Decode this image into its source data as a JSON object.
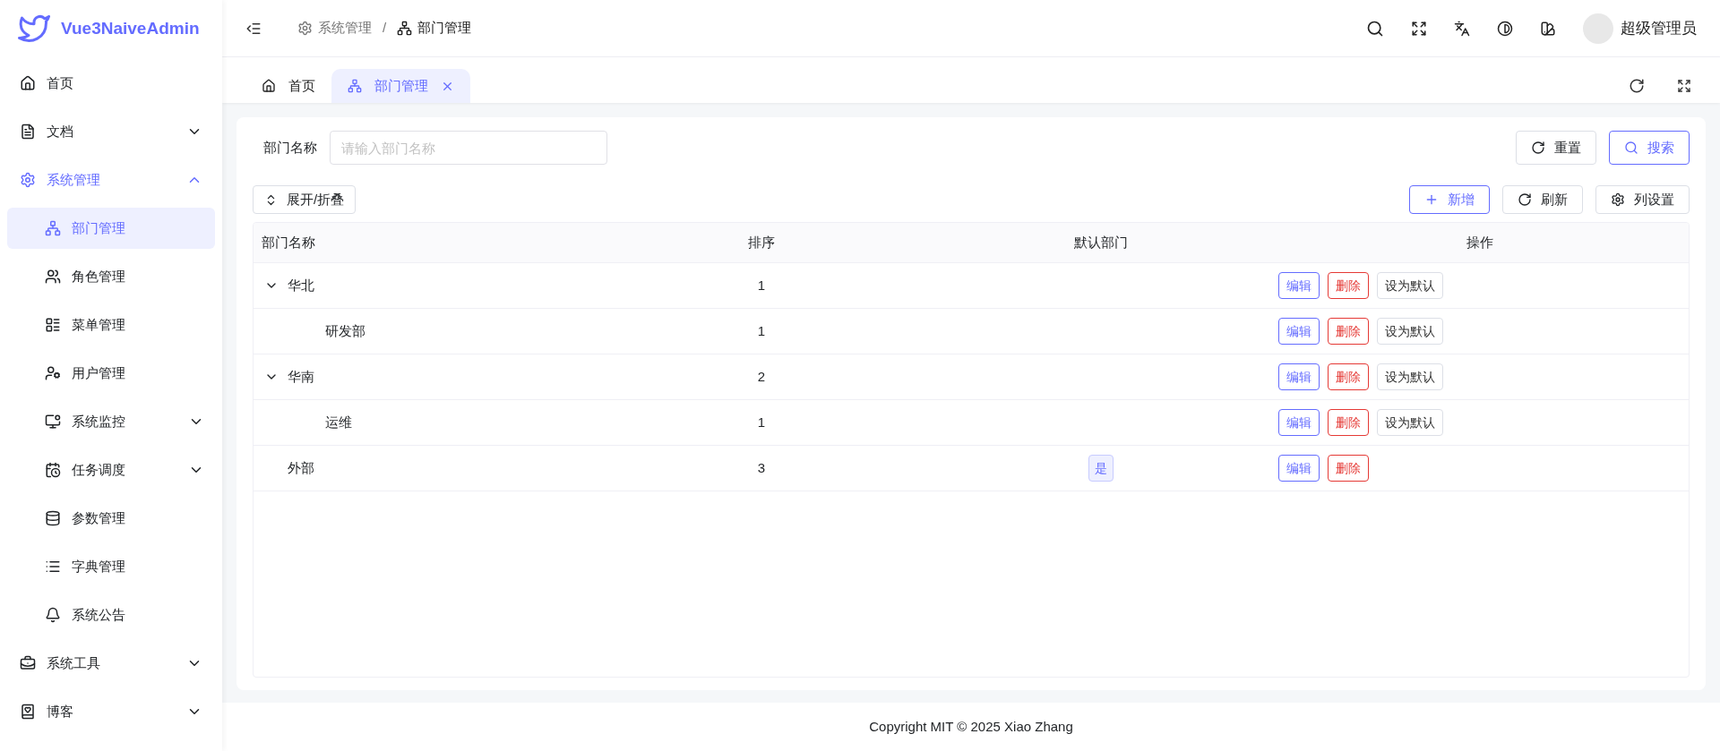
{
  "sidebar": {
    "logo": "Vue3NaiveAdmin",
    "items": [
      {
        "label": "首页",
        "selected": false
      },
      {
        "label": "文档",
        "selected": false,
        "expanded": false
      },
      {
        "label": "系统管理",
        "selected": false,
        "expanded": true,
        "children": [
          {
            "label": "部门管理",
            "selected": true
          },
          {
            "label": "角色管理",
            "selected": false
          },
          {
            "label": "菜单管理",
            "selected": false
          },
          {
            "label": "用户管理",
            "selected": false
          },
          {
            "label": "系统监控",
            "selected": false,
            "expanded": false
          },
          {
            "label": "任务调度",
            "selected": false,
            "expanded": false
          },
          {
            "label": "参数管理",
            "selected": false
          },
          {
            "label": "字典管理",
            "selected": false
          },
          {
            "label": "系统公告",
            "selected": false
          }
        ]
      },
      {
        "label": "系统工具",
        "selected": false,
        "expanded": false
      },
      {
        "label": "博客",
        "selected": false,
        "expanded": false
      }
    ]
  },
  "header": {
    "breadcrumb": [
      "系统管理",
      "部门管理"
    ],
    "separator": "/",
    "user": "超级管理员"
  },
  "tabs": [
    {
      "label": "首页",
      "selected": false
    },
    {
      "label": "部门管理",
      "selected": true
    }
  ],
  "search": {
    "label": "部门名称",
    "placeholder": "请输入部门名称",
    "buttons": [
      {
        "label": "重置",
        "kind": "reset"
      },
      {
        "label": "搜索",
        "kind": "search"
      }
    ]
  },
  "toolbar": {
    "left": "展开/折叠",
    "right": [
      {
        "label": "新增",
        "kind": "add"
      },
      {
        "label": "刷新",
        "kind": "refresh"
      },
      {
        "label": "列设置",
        "kind": "settings"
      }
    ]
  },
  "table": {
    "columns": [
      "部门名称",
      "排序",
      "默认部门",
      "操作"
    ],
    "rows": [
      {
        "name": "华北",
        "sort": "1",
        "expanded": true,
        "actions": [
          {
            "label": "编辑",
            "kind": "edit"
          },
          {
            "label": "删除",
            "kind": "delete"
          },
          {
            "label": "设为默认",
            "kind": "plain"
          }
        ],
        "children": [
          {
            "name": "研发部",
            "sort": "1",
            "actions": [
              {
                "label": "编辑",
                "kind": "edit"
              },
              {
                "label": "删除",
                "kind": "delete"
              },
              {
                "label": "设为默认",
                "kind": "plain"
              }
            ]
          }
        ]
      },
      {
        "name": "华南",
        "sort": "2",
        "expanded": true,
        "actions": [
          {
            "label": "编辑",
            "kind": "edit"
          },
          {
            "label": "删除",
            "kind": "delete"
          },
          {
            "label": "设为默认",
            "kind": "plain"
          }
        ],
        "children": [
          {
            "name": "运维",
            "sort": "1",
            "actions": [
              {
                "label": "编辑",
                "kind": "edit"
              },
              {
                "label": "删除",
                "kind": "delete"
              },
              {
                "label": "设为默认",
                "kind": "plain"
              }
            ]
          }
        ]
      },
      {
        "name": "外部",
        "sort": "3",
        "default_tag": "是",
        "actions": [
          {
            "label": "编辑",
            "kind": "edit"
          },
          {
            "label": "删除",
            "kind": "delete"
          }
        ]
      }
    ]
  },
  "footer": "Copyright MIT © 2025 Xiao Zhang"
}
